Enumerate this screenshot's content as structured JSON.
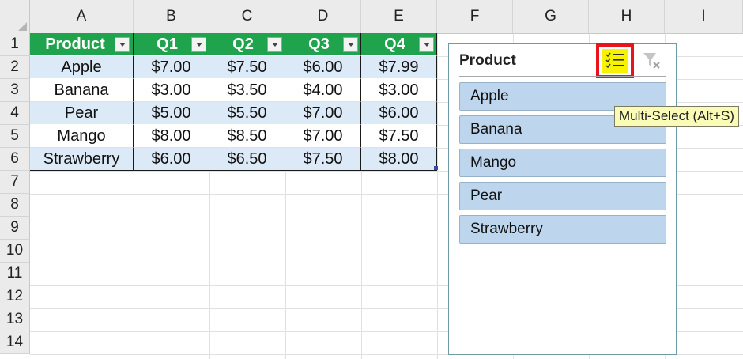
{
  "columns": [
    "A",
    "B",
    "C",
    "D",
    "E",
    "F",
    "G",
    "H",
    "I"
  ],
  "rows": [
    "1",
    "2",
    "3",
    "4",
    "5",
    "6",
    "7",
    "8",
    "9",
    "10",
    "11",
    "12",
    "13",
    "14"
  ],
  "table": {
    "headers": [
      "Product",
      "Q1",
      "Q2",
      "Q3",
      "Q4"
    ],
    "data": [
      [
        "Apple",
        "$7.00",
        "$7.50",
        "$6.00",
        "$7.99"
      ],
      [
        "Banana",
        "$3.00",
        "$3.50",
        "$4.00",
        "$3.00"
      ],
      [
        "Pear",
        "$5.00",
        "$5.50",
        "$7.00",
        "$6.00"
      ],
      [
        "Mango",
        "$8.00",
        "$8.50",
        "$7.00",
        "$7.50"
      ],
      [
        "Strawberry",
        "$6.00",
        "$6.50",
        "$7.50",
        "$8.00"
      ]
    ]
  },
  "slicer": {
    "title": "Product",
    "items": [
      "Apple",
      "Banana",
      "Mango",
      "Pear",
      "Strawberry"
    ],
    "multi_select_icon": "multi-select-icon",
    "clear_filter_icon": "clear-filter-icon"
  },
  "tooltip": {
    "text": "Multi-Select (Alt+S)"
  },
  "colors": {
    "header_fill": "#1fa34d",
    "band_fill": "#dce9f6",
    "slicer_item_fill": "#bdd6ee",
    "highlight_border": "#e8141b",
    "highlight_fill": "#f6f200"
  }
}
